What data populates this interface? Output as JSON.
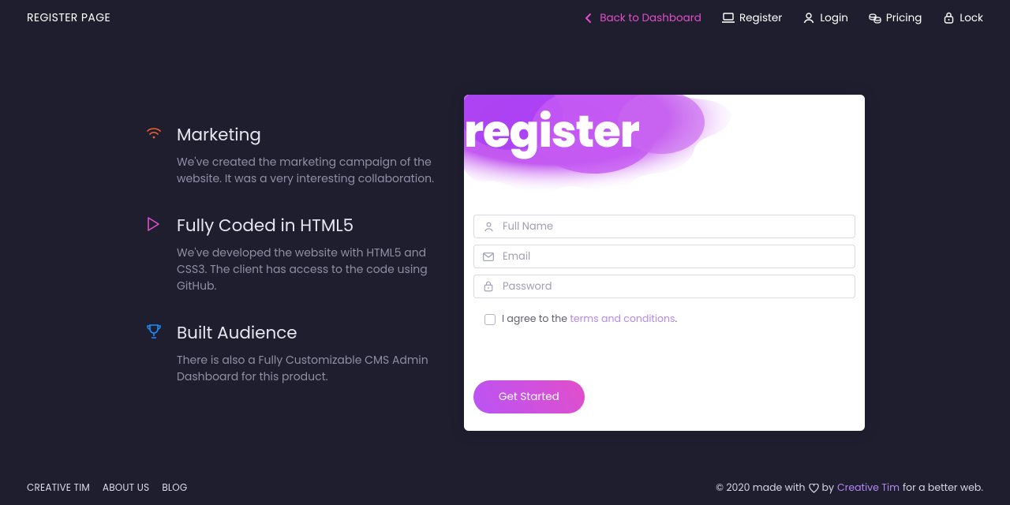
{
  "brand": "REGISTER PAGE",
  "nav": {
    "back": "Back to Dashboard",
    "register": "Register",
    "login": "Login",
    "pricing": "Pricing",
    "lock": "Lock"
  },
  "features": [
    {
      "title": "Marketing",
      "desc": "We've created the marketing campaign of the website. It was a very interesting collaboration."
    },
    {
      "title": "Fully Coded in HTML5",
      "desc": "We've developed the website with HTML5 and CSS3. The client has access to the code using GitHub."
    },
    {
      "title": "Built Audience",
      "desc": "There is also a Fully Customizable CMS Admin Dashboard for this product."
    }
  ],
  "card": {
    "heading": "register",
    "fullname_ph": "Full Name",
    "email_ph": "Email",
    "password_ph": "Password",
    "agree_prefix": "I agree to the ",
    "agree_link": "terms and conditions",
    "agree_suffix": ".",
    "submit": "Get Started"
  },
  "footer": {
    "links": [
      "CREATIVE TIM",
      "ABOUT US",
      "BLOG"
    ],
    "copy_prefix": "© 2020 made with",
    "by": "by",
    "ct": "Creative Tim",
    "tail": "for a better web."
  }
}
